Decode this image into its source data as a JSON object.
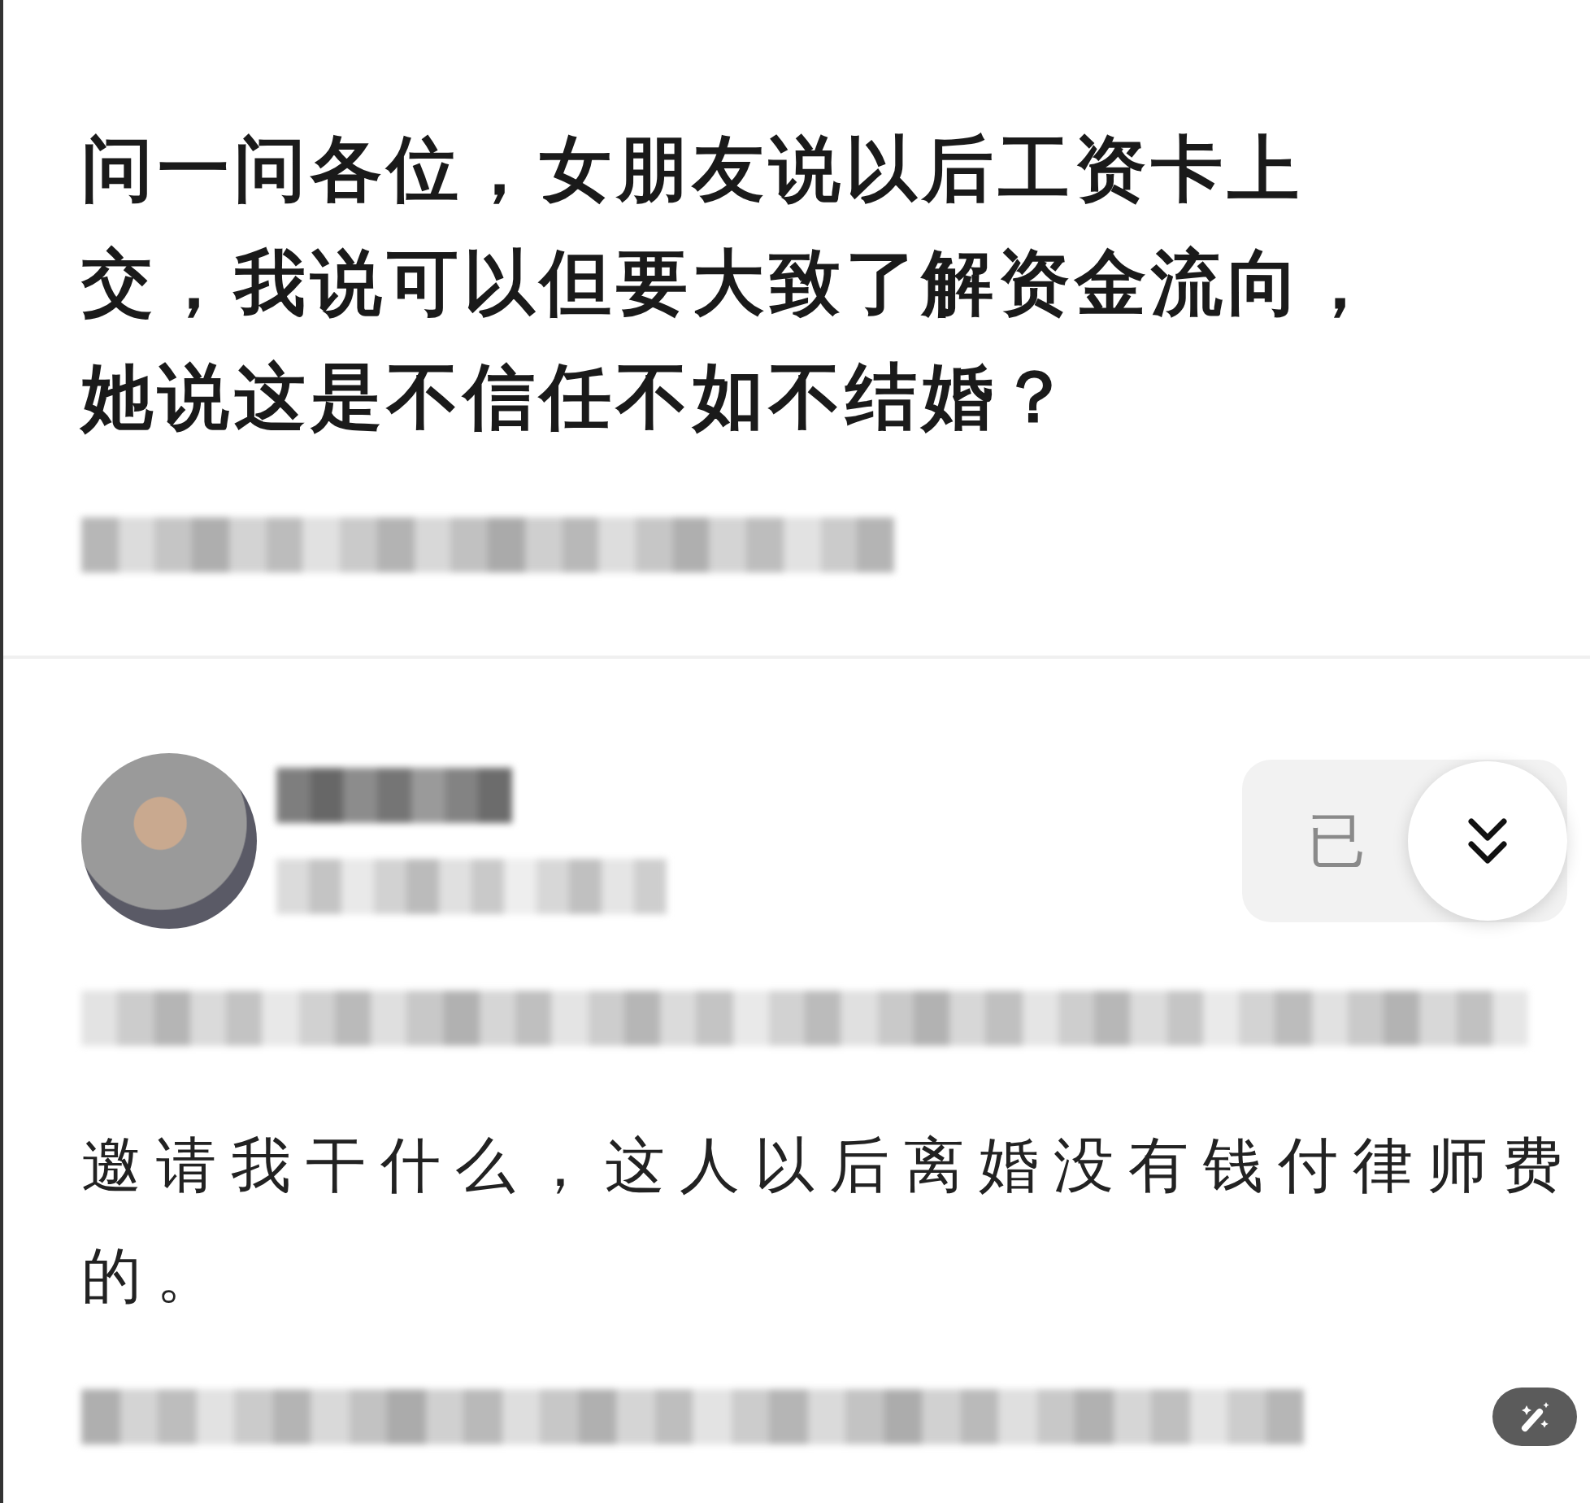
{
  "question": {
    "title_lines": [
      "问一问各位，女朋友说以后工资卡上",
      "交，我说可以但要大致了解资金流向，",
      "她说这是不信任不如不结婚？"
    ]
  },
  "answer": {
    "follow_button": {
      "label": "已"
    },
    "text": "邀请我干什么，这人以后离婚没有钱付律师费的。"
  }
}
